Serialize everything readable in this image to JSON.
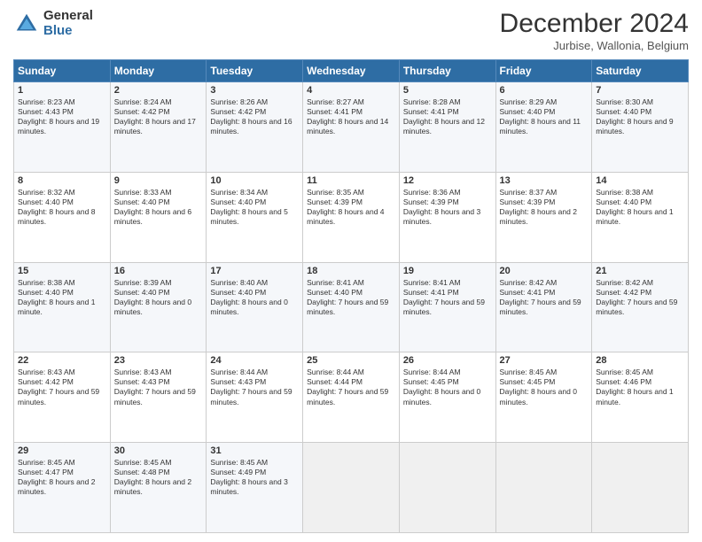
{
  "logo": {
    "general": "General",
    "blue": "Blue"
  },
  "header": {
    "title": "December 2024",
    "subtitle": "Jurbise, Wallonia, Belgium"
  },
  "days_of_week": [
    "Sunday",
    "Monday",
    "Tuesday",
    "Wednesday",
    "Thursday",
    "Friday",
    "Saturday"
  ],
  "weeks": [
    [
      {
        "day": "1",
        "sunrise": "8:23 AM",
        "sunset": "4:43 PM",
        "daylight": "8 hours and 19 minutes."
      },
      {
        "day": "2",
        "sunrise": "8:24 AM",
        "sunset": "4:42 PM",
        "daylight": "8 hours and 17 minutes."
      },
      {
        "day": "3",
        "sunrise": "8:26 AM",
        "sunset": "4:42 PM",
        "daylight": "8 hours and 16 minutes."
      },
      {
        "day": "4",
        "sunrise": "8:27 AM",
        "sunset": "4:41 PM",
        "daylight": "8 hours and 14 minutes."
      },
      {
        "day": "5",
        "sunrise": "8:28 AM",
        "sunset": "4:41 PM",
        "daylight": "8 hours and 12 minutes."
      },
      {
        "day": "6",
        "sunrise": "8:29 AM",
        "sunset": "4:40 PM",
        "daylight": "8 hours and 11 minutes."
      },
      {
        "day": "7",
        "sunrise": "8:30 AM",
        "sunset": "4:40 PM",
        "daylight": "8 hours and 9 minutes."
      }
    ],
    [
      {
        "day": "8",
        "sunrise": "8:32 AM",
        "sunset": "4:40 PM",
        "daylight": "8 hours and 8 minutes."
      },
      {
        "day": "9",
        "sunrise": "8:33 AM",
        "sunset": "4:40 PM",
        "daylight": "8 hours and 6 minutes."
      },
      {
        "day": "10",
        "sunrise": "8:34 AM",
        "sunset": "4:40 PM",
        "daylight": "8 hours and 5 minutes."
      },
      {
        "day": "11",
        "sunrise": "8:35 AM",
        "sunset": "4:39 PM",
        "daylight": "8 hours and 4 minutes."
      },
      {
        "day": "12",
        "sunrise": "8:36 AM",
        "sunset": "4:39 PM",
        "daylight": "8 hours and 3 minutes."
      },
      {
        "day": "13",
        "sunrise": "8:37 AM",
        "sunset": "4:39 PM",
        "daylight": "8 hours and 2 minutes."
      },
      {
        "day": "14",
        "sunrise": "8:38 AM",
        "sunset": "4:40 PM",
        "daylight": "8 hours and 1 minute."
      }
    ],
    [
      {
        "day": "15",
        "sunrise": "8:38 AM",
        "sunset": "4:40 PM",
        "daylight": "8 hours and 1 minute."
      },
      {
        "day": "16",
        "sunrise": "8:39 AM",
        "sunset": "4:40 PM",
        "daylight": "8 hours and 0 minutes."
      },
      {
        "day": "17",
        "sunrise": "8:40 AM",
        "sunset": "4:40 PM",
        "daylight": "8 hours and 0 minutes."
      },
      {
        "day": "18",
        "sunrise": "8:41 AM",
        "sunset": "4:40 PM",
        "daylight": "7 hours and 59 minutes."
      },
      {
        "day": "19",
        "sunrise": "8:41 AM",
        "sunset": "4:41 PM",
        "daylight": "7 hours and 59 minutes."
      },
      {
        "day": "20",
        "sunrise": "8:42 AM",
        "sunset": "4:41 PM",
        "daylight": "7 hours and 59 minutes."
      },
      {
        "day": "21",
        "sunrise": "8:42 AM",
        "sunset": "4:42 PM",
        "daylight": "7 hours and 59 minutes."
      }
    ],
    [
      {
        "day": "22",
        "sunrise": "8:43 AM",
        "sunset": "4:42 PM",
        "daylight": "7 hours and 59 minutes."
      },
      {
        "day": "23",
        "sunrise": "8:43 AM",
        "sunset": "4:43 PM",
        "daylight": "7 hours and 59 minutes."
      },
      {
        "day": "24",
        "sunrise": "8:44 AM",
        "sunset": "4:43 PM",
        "daylight": "7 hours and 59 minutes."
      },
      {
        "day": "25",
        "sunrise": "8:44 AM",
        "sunset": "4:44 PM",
        "daylight": "7 hours and 59 minutes."
      },
      {
        "day": "26",
        "sunrise": "8:44 AM",
        "sunset": "4:45 PM",
        "daylight": "8 hours and 0 minutes."
      },
      {
        "day": "27",
        "sunrise": "8:45 AM",
        "sunset": "4:45 PM",
        "daylight": "8 hours and 0 minutes."
      },
      {
        "day": "28",
        "sunrise": "8:45 AM",
        "sunset": "4:46 PM",
        "daylight": "8 hours and 1 minute."
      }
    ],
    [
      {
        "day": "29",
        "sunrise": "8:45 AM",
        "sunset": "4:47 PM",
        "daylight": "8 hours and 2 minutes."
      },
      {
        "day": "30",
        "sunrise": "8:45 AM",
        "sunset": "4:48 PM",
        "daylight": "8 hours and 2 minutes."
      },
      {
        "day": "31",
        "sunrise": "8:45 AM",
        "sunset": "4:49 PM",
        "daylight": "8 hours and 3 minutes."
      },
      null,
      null,
      null,
      null
    ]
  ]
}
